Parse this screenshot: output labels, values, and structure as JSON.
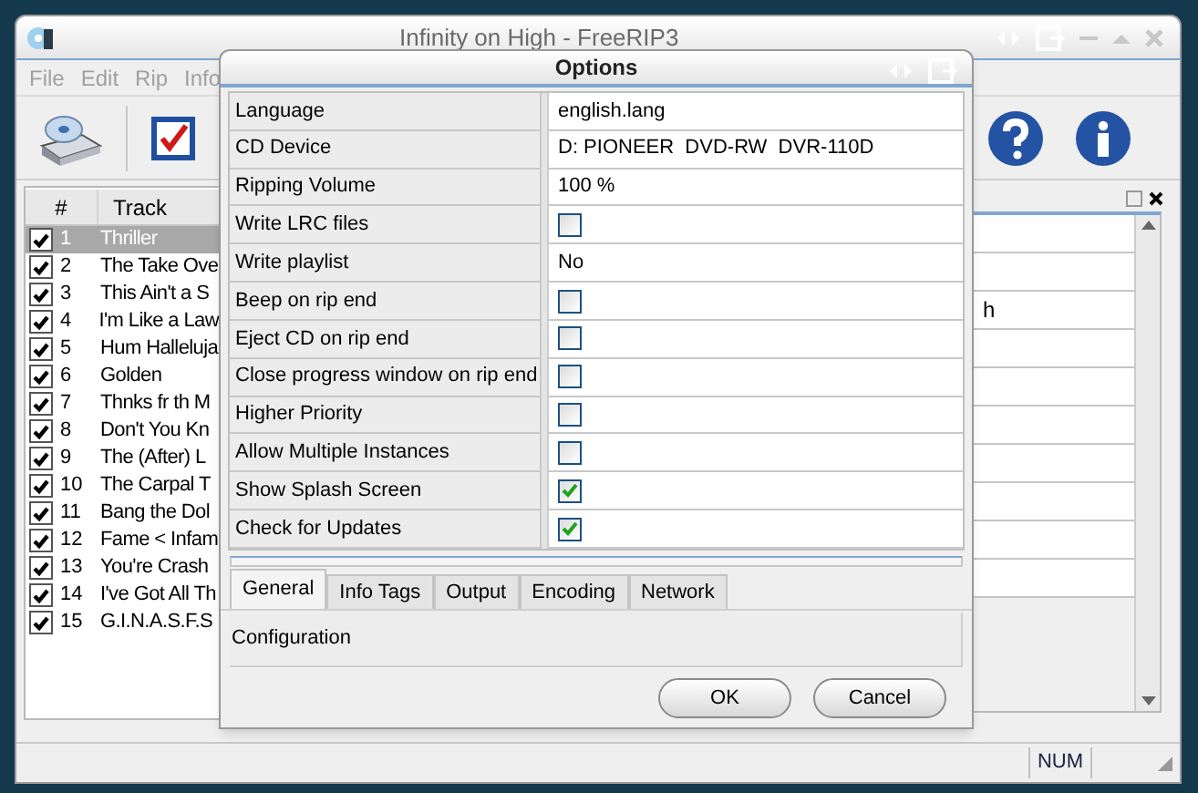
{
  "window": {
    "title": "Infinity on High - FreeRIP3"
  },
  "menu": [
    "File",
    "Edit",
    "Rip",
    "Info"
  ],
  "track_list": {
    "columns": [
      "#",
      "Track"
    ],
    "rows": [
      {
        "number": "1",
        "track": "Thriller",
        "checked": true,
        "selected": true
      },
      {
        "number": "2",
        "track": "The Take Ove",
        "checked": true,
        "selected": false
      },
      {
        "number": "3",
        "track": "This Ain't a S",
        "checked": true,
        "selected": false
      },
      {
        "number": "4",
        "track": "I'm Like a Law",
        "checked": true,
        "selected": false
      },
      {
        "number": "5",
        "track": "Hum Halleluja",
        "checked": true,
        "selected": false
      },
      {
        "number": "6",
        "track": "Golden",
        "checked": true,
        "selected": false
      },
      {
        "number": "7",
        "track": "Thnks fr th M",
        "checked": true,
        "selected": false
      },
      {
        "number": "8",
        "track": "Don't You Kn",
        "checked": true,
        "selected": false
      },
      {
        "number": "9",
        "track": "The (After) L",
        "checked": true,
        "selected": false
      },
      {
        "number": "10",
        "track": "The Carpal T",
        "checked": true,
        "selected": false
      },
      {
        "number": "11",
        "track": "Bang the Dol",
        "checked": true,
        "selected": false
      },
      {
        "number": "12",
        "track": "Fame < Infam",
        "checked": true,
        "selected": false
      },
      {
        "number": "13",
        "track": "You're Crash",
        "checked": true,
        "selected": false
      },
      {
        "number": "14",
        "track": "I've Got All Th",
        "checked": true,
        "selected": false
      },
      {
        "number": "15",
        "track": "G.I.N.A.S.F.S",
        "checked": true,
        "selected": false
      }
    ]
  },
  "side_pane": {
    "text": "h"
  },
  "status_bar": {
    "indicator": "NUM"
  },
  "dialog": {
    "title": "Options",
    "settings": [
      {
        "label": "Language",
        "kind": "text",
        "value": "english.lang"
      },
      {
        "label": "CD Device",
        "kind": "text",
        "value": "D: PIONEER  DVD-RW  DVR-110D"
      },
      {
        "label": "Ripping Volume",
        "kind": "text",
        "value": "100 %"
      },
      {
        "label": "Write LRC files",
        "kind": "checkbox",
        "checked": false
      },
      {
        "label": "Write playlist",
        "kind": "text",
        "value": "No"
      },
      {
        "label": "Beep on rip end",
        "kind": "checkbox",
        "checked": false
      },
      {
        "label": "Eject CD on rip end",
        "kind": "checkbox",
        "checked": false
      },
      {
        "label": "Close progress window on rip end",
        "kind": "checkbox",
        "checked": false
      },
      {
        "label": "Higher Priority",
        "kind": "checkbox",
        "checked": false
      },
      {
        "label": "Allow Multiple Instances",
        "kind": "checkbox",
        "checked": false
      },
      {
        "label": "Show Splash Screen",
        "kind": "checkbox",
        "checked": true
      },
      {
        "label": "Check for Updates",
        "kind": "checkbox",
        "checked": true
      }
    ],
    "tabs": [
      {
        "label": "General",
        "selected": true
      },
      {
        "label": "Info Tags",
        "selected": false
      },
      {
        "label": "Output",
        "selected": false
      },
      {
        "label": "Encoding",
        "selected": false
      },
      {
        "label": "Network",
        "selected": false
      }
    ],
    "section": "Configuration",
    "buttons": [
      "OK",
      "Cancel"
    ]
  }
}
